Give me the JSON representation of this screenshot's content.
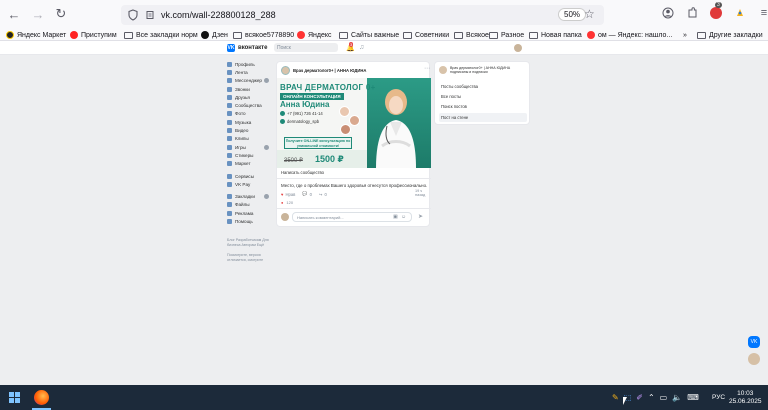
{
  "browser": {
    "url": "vk.com/wall-228800128_288",
    "zoom": "50%",
    "notification_count": "3",
    "bookmarks": [
      {
        "label": "Яндекс Маркет",
        "icon": "yandex-market-icon"
      },
      {
        "label": "Приступим",
        "icon": "yandex-icon"
      },
      {
        "label": "Все закладки норм",
        "icon": "folder-icon"
      },
      {
        "label": "Дзен",
        "icon": "dzen-icon"
      },
      {
        "label": "всякое5778890",
        "icon": "folder-icon"
      },
      {
        "label": "Яндекс",
        "icon": "yandex-icon"
      },
      {
        "label": "Сайты важные",
        "icon": "folder-icon"
      },
      {
        "label": "Советники",
        "icon": "folder-icon"
      },
      {
        "label": "Всякое",
        "icon": "folder-icon"
      },
      {
        "label": "Разное",
        "icon": "folder-icon"
      },
      {
        "label": "Новая папка",
        "icon": "folder-icon"
      },
      {
        "label": "ом — Яндекс: нашло...",
        "icon": "yandex-icon"
      },
      {
        "label": "Другие закладки",
        "icon": "folder-icon"
      }
    ]
  },
  "vk": {
    "logo_text": "вконтакте",
    "search_placeholder": "Поиск",
    "bell_count": "3",
    "menu": [
      {
        "label": "Профиль"
      },
      {
        "label": "Лента"
      },
      {
        "label": "Мессенджер"
      },
      {
        "label": "Звонки"
      },
      {
        "label": "Друзья"
      },
      {
        "label": "Сообщества"
      },
      {
        "label": "Фото"
      },
      {
        "label": "Музыка"
      },
      {
        "label": "Видео"
      },
      {
        "label": "Клипы"
      },
      {
        "label": "Игры"
      },
      {
        "label": "Стикеры"
      },
      {
        "label": "Маркет"
      },
      {
        "label": "Сервисы"
      },
      {
        "label": "VK Pay"
      },
      {
        "label": "Закладки"
      },
      {
        "label": "Файлы"
      },
      {
        "label": "Реклама"
      },
      {
        "label": "Помощь"
      }
    ],
    "footer": "Блог Разработчикам Для бизнеса Авторам Ещё",
    "footer2": "Посмотрите, версия отличается, смотрите"
  },
  "post": {
    "author": "Врач дерматолог0+ | АННА ЮДИНА",
    "banner": {
      "title": "ВРАЧ ДЕРМАТОЛОГ 0+",
      "online": "ОНЛАЙН КОНСУЛЬТАЦИЯ",
      "name": "Анна Юдина",
      "phone": "+7 (991) 726 41-14",
      "instagram": "dermatology_spb",
      "promo": "Получите ON-LINE консультацию по уникальной стоимости!",
      "old_price": "3500 ₽",
      "new_price": "1500 ₽"
    },
    "write_label": "Написать сообщество",
    "text": "Место, где о проблемах Вашего здоровья отнесутся профессионально.",
    "time": "19 ч назад",
    "like_label": "Нрав",
    "comments": "0",
    "reposts": "0",
    "views": "1К",
    "likes": "120",
    "comment_placeholder": "Написать комментарий..."
  },
  "side": {
    "title": "Врач дерматолог0+ | АННА ЮДИНА подписаны и подписки",
    "items": [
      {
        "label": "Посты сообщества"
      },
      {
        "label": "Все посты"
      },
      {
        "label": "Поиск постов"
      },
      {
        "label": "Пост на стене"
      }
    ]
  },
  "taskbar": {
    "lang": "РУС",
    "time": "10:03",
    "date": "25.06.2025"
  }
}
